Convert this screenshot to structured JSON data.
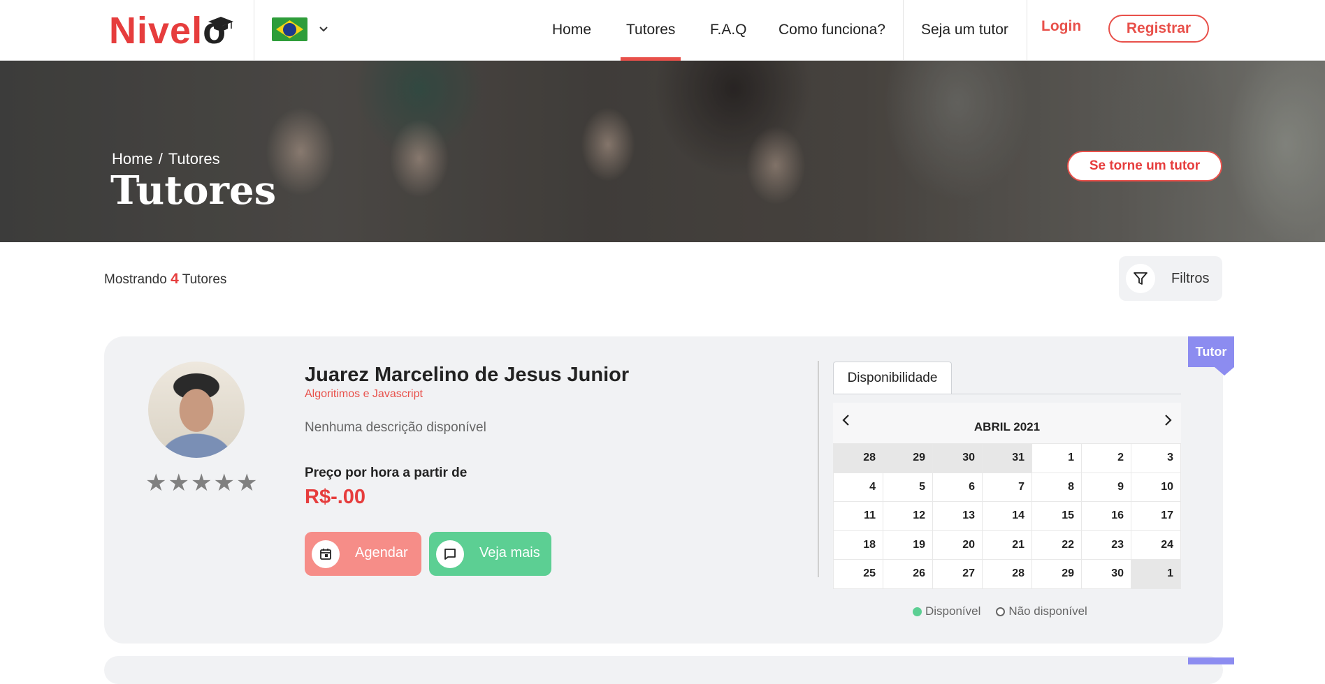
{
  "header": {
    "logo": {
      "main": "Nivel",
      "last": "o"
    },
    "language": {
      "icon": "brazil-flag-icon",
      "dropdown_icon": "chevron-down-icon"
    },
    "nav": [
      {
        "label": "Home"
      },
      {
        "label": "Tutores",
        "active": true
      },
      {
        "label": "F.A.Q"
      },
      {
        "label": "Como funciona?"
      },
      {
        "label": "Seja um tutor"
      }
    ],
    "login_label": "Login",
    "register_label": "Registrar"
  },
  "hero": {
    "breadcrumb": {
      "home": "Home",
      "separator": "/",
      "current": "Tutores"
    },
    "title": "Tutores",
    "cta_label": "Se torne um tutor"
  },
  "results": {
    "prefix": "Mostrando",
    "count": "4",
    "suffix": "Tutores",
    "filters_label": "Filtros",
    "filters_icon": "filter-icon"
  },
  "tutor": {
    "badge": "Tutor",
    "name": "Juarez Marcelino de Jesus Junior",
    "subject": "Algoritimos e Javascript",
    "description": "Nenhuma descrição disponível",
    "price_label": "Preço por hora a partir de",
    "price": "R$-.00",
    "rating_stars": 5,
    "rating_value": 0,
    "buttons": {
      "schedule_label": "Agendar",
      "schedule_icon": "calendar-icon",
      "more_label": "Veja mais",
      "more_icon": "chat-icon"
    },
    "availability": {
      "tab_label": "Disponibilidade",
      "month_title": "ABRIL 2021",
      "prev_icon": "chevron-left-icon",
      "next_icon": "chevron-right-icon",
      "weeks": [
        [
          "28",
          "29",
          "30",
          "31",
          "1",
          "2",
          "3"
        ],
        [
          "4",
          "5",
          "6",
          "7",
          "8",
          "9",
          "10"
        ],
        [
          "11",
          "12",
          "13",
          "14",
          "15",
          "16",
          "17"
        ],
        [
          "18",
          "19",
          "20",
          "21",
          "22",
          "23",
          "24"
        ],
        [
          "25",
          "26",
          "27",
          "28",
          "29",
          "30",
          "1"
        ]
      ],
      "outside_month": [
        [
          0,
          0
        ],
        [
          0,
          1
        ],
        [
          0,
          2
        ],
        [
          0,
          3
        ],
        [
          4,
          6
        ]
      ],
      "legend_available": "Disponível",
      "legend_unavailable": "Não disponível",
      "colors": {
        "available": "#5ccf93",
        "unavailable": "#666666"
      }
    }
  },
  "colors": {
    "brand": "#e63d3d",
    "accent": "#e8504a",
    "badge": "#8c8cf0",
    "schedule_button": "#f68d88",
    "more_button": "#5ccf93"
  }
}
